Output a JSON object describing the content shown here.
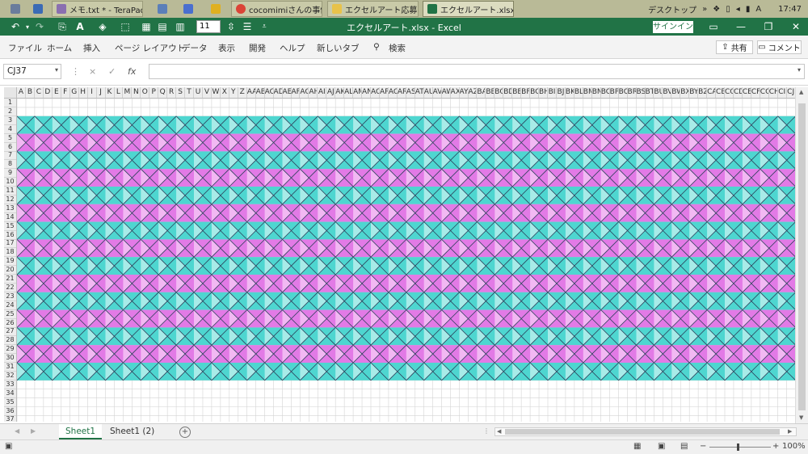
{
  "taskbar": {
    "tasks": [
      {
        "label": "メモ.txt * - TeraPad",
        "icon": "terapad-icon",
        "color": "#8a6fb0"
      },
      {
        "label": "",
        "icon": "document-icon",
        "color": "#5b7fb9"
      },
      {
        "label": "",
        "icon": "calendar-icon",
        "color": "#4a6fcf"
      },
      {
        "label": "",
        "icon": "sticky-note-icon",
        "color": "#e0b020"
      },
      {
        "label": "cocomimiさんの事例...",
        "icon": "chrome-icon",
        "color": "#db4437"
      },
      {
        "label": "エクセルアート応募",
        "icon": "folder-icon",
        "color": "#e8c24a"
      },
      {
        "label": "エクセルアート.xlsx - ...",
        "icon": "excel-icon",
        "color": "#217346"
      }
    ],
    "tray": {
      "desktop_label": "デスクトップ",
      "chevron": "»",
      "ime": "A",
      "time": "17:47"
    }
  },
  "titlebar": {
    "font_size": "11",
    "title": "エクセルアート.xlsx  -  Excel",
    "signin": "サインイン"
  },
  "ribbon": {
    "tabs": [
      "ファイル",
      "ホーム",
      "挿入",
      "ページ レイアウト",
      "データ",
      "表示",
      "開発",
      "ヘルプ",
      "新しいタブ"
    ],
    "search_label": "検索",
    "share_label": "共有",
    "comment_label": "コメント"
  },
  "formula_bar": {
    "name_box": "CJ37",
    "cancel_symbol": "×",
    "enter_symbol": "✓",
    "fx_symbol": "fx",
    "formula": ""
  },
  "grid": {
    "column_headers": [
      "A",
      "B",
      "C",
      "D",
      "E",
      "F",
      "G",
      "H",
      "I",
      "J",
      "K",
      "L",
      "M",
      "N",
      "O",
      "P",
      "Q",
      "R",
      "S",
      "T",
      "U",
      "V",
      "W",
      "X",
      "Y",
      "Z",
      "AA",
      "AB",
      "AC",
      "AD",
      "AE",
      "AF",
      "AG",
      "AH",
      "AI",
      "AJ",
      "AK",
      "AL",
      "AM",
      "AN",
      "AO",
      "AP",
      "AQ",
      "AR",
      "AS",
      "AT",
      "AU",
      "AV",
      "AW",
      "AX",
      "AY",
      "AZ",
      "BA",
      "BB",
      "BC",
      "BD",
      "BE",
      "BF",
      "BG",
      "BH",
      "BI",
      "BJ",
      "BK",
      "BL",
      "BM",
      "BN",
      "BO",
      "BP",
      "BQ",
      "BR",
      "BS",
      "BT",
      "BU",
      "BV",
      "BW",
      "BX",
      "BY",
      "BZ",
      "CA",
      "CB",
      "CC",
      "CD",
      "CE",
      "CF",
      "CG",
      "CH",
      "CI",
      "CJ",
      "CK",
      "CL"
    ],
    "row_headers": [
      "1",
      "2",
      "3",
      "4",
      "5",
      "6",
      "7",
      "8",
      "9",
      "10",
      "11",
      "12",
      "13",
      "14",
      "15",
      "16",
      "17",
      "18",
      "19",
      "20",
      "21",
      "22",
      "23",
      "24",
      "25",
      "26",
      "27",
      "28",
      "29",
      "30",
      "31",
      "32",
      "33",
      "34",
      "35",
      "36",
      "37"
    ],
    "colors": {
      "teal": "#4ed6d0",
      "teal_light": "#a8ebe8",
      "pink": "#e27ae6",
      "pink_light": "#f2b8f3",
      "line": "#2b3f5a",
      "gridline": "#d4d4d4"
    }
  },
  "sheets": {
    "tabs": [
      "Sheet1",
      "Sheet1 (2)"
    ],
    "active": "Sheet1",
    "add_symbol": "+"
  },
  "status": {
    "zoom": "100%"
  }
}
